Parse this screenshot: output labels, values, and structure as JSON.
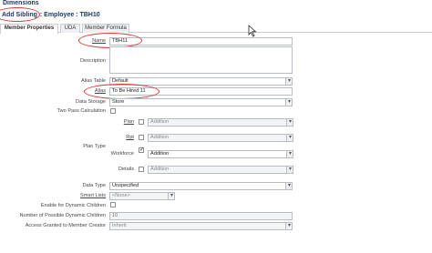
{
  "header": {
    "dimensions_title": "Dimensions",
    "add_sibling": "Add Sibling",
    "employee": ": Employee : TBH10"
  },
  "tabs": [
    {
      "label": "Member Properties",
      "active": true
    },
    {
      "label": "UDA",
      "active": false
    },
    {
      "label": "Member Formula",
      "active": false
    }
  ],
  "form": {
    "name_label": "Name",
    "name_value": "TBH11",
    "description_label": "Description",
    "alias_table_label": "Alias Table",
    "alias_table_value": "Default",
    "alias_label": "Alias",
    "alias_value": "To Be Hired 11",
    "data_storage_label": "Data Storage",
    "data_storage_value": "Store",
    "two_pass_label": "Two Pass Calculation",
    "plan_type_label": "Plan Type",
    "plan_label": "Plan",
    "plan_value": "Addition",
    "rpt_label": "Rpt",
    "rpt_value": "Addition",
    "workforce_label": "Workforce",
    "workforce_value": "Addition",
    "workforce_checked": true,
    "details_label": "Details",
    "details_value": "Addition",
    "data_type_label": "Data Type",
    "data_type_value": "Unspecified",
    "smart_lists_label": "Smart Lists",
    "smart_lists_value": "<None>",
    "enable_dynamic_label": "Enable for Dynamic Children",
    "num_dynamic_label": "Number of Possible Dynamic Children",
    "num_dynamic_value": "10",
    "access_label": "Access Granted to Member Creator",
    "access_value": "Inherit"
  },
  "colors": {
    "highlight": "#d63b3b",
    "title": "#1a3a6b"
  }
}
